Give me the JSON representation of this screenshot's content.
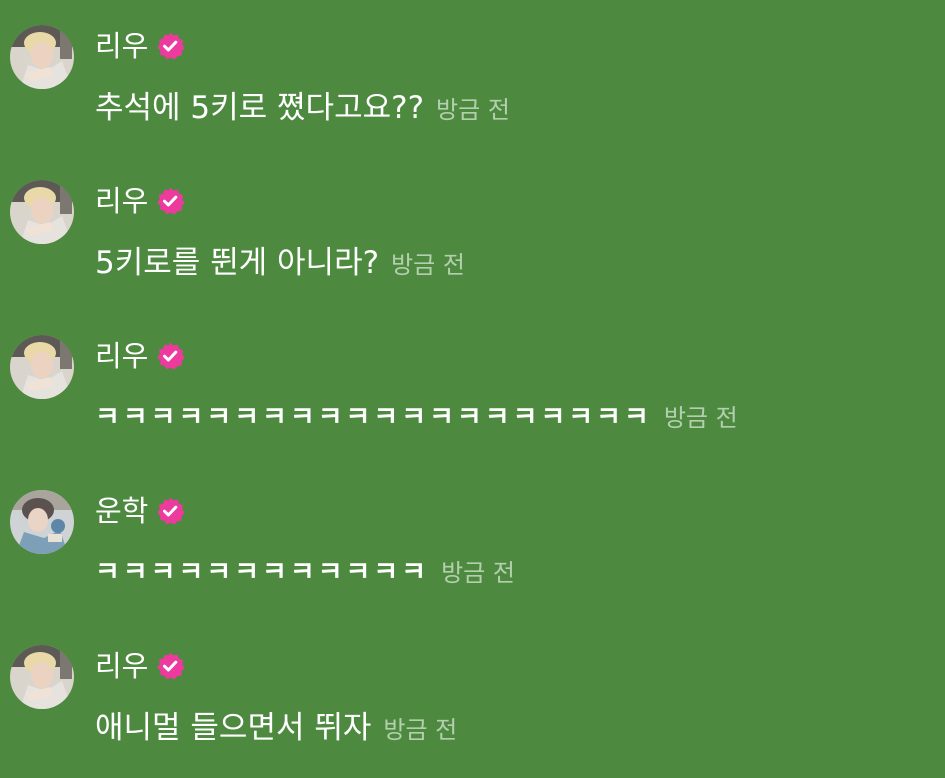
{
  "colors": {
    "background": "#4d8a40",
    "text": "#ffffff",
    "timestamp": "#b4cfae",
    "verified_badge": "#ec3a9d"
  },
  "messages": [
    {
      "author": "리우",
      "avatar": "avatar-riu",
      "verified": true,
      "text": "추석에 5키로 쪘다고요??",
      "time": "방금 전"
    },
    {
      "author": "리우",
      "avatar": "avatar-riu",
      "verified": true,
      "text": "5키로를 뛴게 아니라?",
      "time": "방금 전"
    },
    {
      "author": "리우",
      "avatar": "avatar-riu",
      "verified": true,
      "text": "ㅋㅋㅋㅋㅋㅋㅋㅋㅋㅋㅋㅋㅋㅋㅋㅋㅋㅋㅋㅋ",
      "time": "방금 전"
    },
    {
      "author": "운학",
      "avatar": "avatar-unhak",
      "verified": true,
      "text": "ㅋㅋㅋㅋㅋㅋㅋㅋㅋㅋㅋㅋ",
      "time": "방금 전"
    },
    {
      "author": "리우",
      "avatar": "avatar-riu",
      "verified": true,
      "text": "애니멀 들으면서 뛰자",
      "time": "방금 전"
    }
  ]
}
